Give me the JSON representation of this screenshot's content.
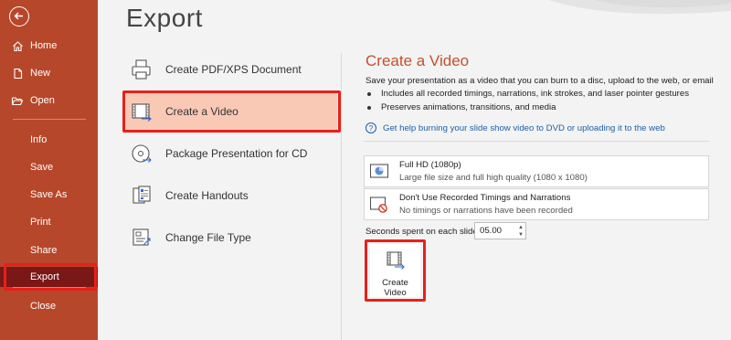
{
  "sidebar": {
    "back_label": "Back",
    "nav_top": [
      {
        "label": "Home",
        "icon": "home-icon"
      },
      {
        "label": "New",
        "icon": "new-file-icon"
      },
      {
        "label": "Open",
        "icon": "open-folder-icon"
      }
    ],
    "nav_mid": [
      "Info",
      "Save",
      "Save As",
      "Print",
      "Share",
      "Export"
    ],
    "nav_bottom": [
      "Close"
    ],
    "selected": "Export",
    "colors": {
      "background": "#b7472a",
      "selected": "#7a1717"
    }
  },
  "page_title": "Export",
  "export_options": [
    {
      "label": "Create PDF/XPS Document",
      "icon": "pdf-xps-icon"
    },
    {
      "label": "Create a Video",
      "icon": "video-film-icon"
    },
    {
      "label": "Package Presentation for CD",
      "icon": "cd-package-icon"
    },
    {
      "label": "Create Handouts",
      "icon": "handouts-icon"
    },
    {
      "label": "Change File Type",
      "icon": "change-file-type-icon"
    }
  ],
  "selected_option": "Create a Video",
  "video_panel": {
    "title": "Create a Video",
    "description": "Save your presentation as a video that you can burn to a disc, upload to the web, or email",
    "bullets": [
      "Includes all recorded timings, narrations, ink strokes, and laser pointer gestures",
      "Preserves animations, transitions, and media"
    ],
    "help_link": "Get help burning your slide show video to DVD or uploading it to the web",
    "quality_select": {
      "main": "Full HD (1080p)",
      "sub": "Large file size and full high quality (1080 x 1080)"
    },
    "timings_select": {
      "main": "Don't Use Recorded Timings and Narrations",
      "sub": "No timings or narrations have been recorded"
    },
    "seconds_label": "Seconds spent on each slide:",
    "seconds_value": "05.00",
    "create_button": {
      "line1": "Create",
      "line2": "Video"
    }
  },
  "colors": {
    "accent": "#c4502c",
    "highlight": "#e8201a",
    "selected_option_bg": "#f9c9b6",
    "link": "#1f5fa8"
  }
}
